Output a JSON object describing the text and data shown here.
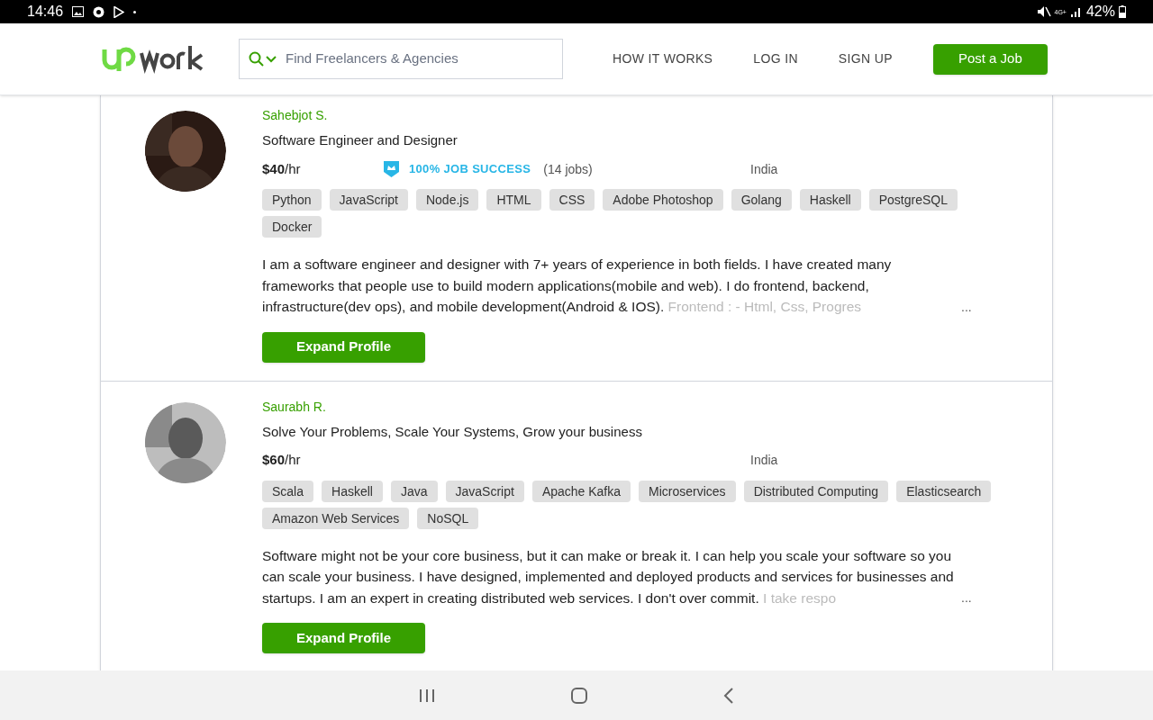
{
  "status_bar": {
    "time": "14:46",
    "network": "4G+",
    "battery": "42%"
  },
  "header": {
    "search": {
      "placeholder": "Find Freelancers & Agencies"
    },
    "nav": [
      "HOW IT WORKS",
      "LOG IN",
      "SIGN UP"
    ],
    "post_button": "Post a Job"
  },
  "freelancers": [
    {
      "name": "Sahebjot S.",
      "title": "Software Engineer and Designer",
      "rate": "$40",
      "rate_unit": "/hr",
      "job_success": "100% JOB SUCCESS",
      "jobs": "(14 jobs)",
      "country": "India",
      "skills": [
        "Python",
        "JavaScript",
        "Node.js",
        "HTML",
        "CSS",
        "Adobe Photoshop",
        "Golang",
        "Haskell",
        "PostgreSQL",
        "Docker"
      ],
      "description": "I am a software engineer and designer with 7+ years of experience in both fields. I have created many frameworks that people use to build modern applications(mobile and web). I do frontend, backend, infrastructure(dev ops), and mobile development(Android & IOS).",
      "description_faded": "Frontend : - Html, Css, Progres",
      "ellipsis": "...",
      "button": "Expand Profile"
    },
    {
      "name": "Saurabh R.",
      "title": "Solve Your Problems, Scale Your Systems, Grow your business",
      "rate": "$60",
      "rate_unit": "/hr",
      "country": "India",
      "skills": [
        "Scala",
        "Haskell",
        "Java",
        "JavaScript",
        "Apache Kafka",
        "Microservices",
        "Distributed Computing",
        "Elasticsearch",
        "Amazon Web Services",
        "NoSQL"
      ],
      "description": "Software might not be your core business, but it can make or break it. I can help you scale your software so you can scale your business. I have designed, implemented and deployed products and services for businesses and startups. I am an expert in creating distributed web services. I don't over commit.",
      "description_faded": "I take respo",
      "ellipsis": "...",
      "button": "Expand Profile"
    }
  ]
}
